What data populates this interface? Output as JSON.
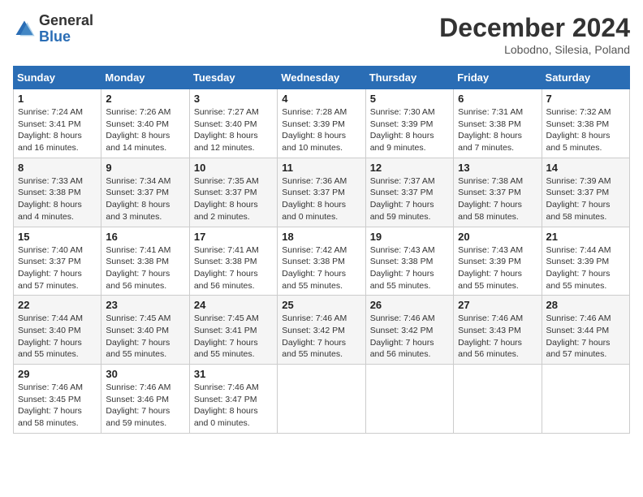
{
  "header": {
    "logo_general": "General",
    "logo_blue": "Blue",
    "month_title": "December 2024",
    "location": "Lobodno, Silesia, Poland"
  },
  "weekdays": [
    "Sunday",
    "Monday",
    "Tuesday",
    "Wednesday",
    "Thursday",
    "Friday",
    "Saturday"
  ],
  "weeks": [
    [
      {
        "day": "1",
        "sunrise": "7:24 AM",
        "sunset": "3:41 PM",
        "daylight": "8 hours and 16 minutes."
      },
      {
        "day": "2",
        "sunrise": "7:26 AM",
        "sunset": "3:40 PM",
        "daylight": "8 hours and 14 minutes."
      },
      {
        "day": "3",
        "sunrise": "7:27 AM",
        "sunset": "3:40 PM",
        "daylight": "8 hours and 12 minutes."
      },
      {
        "day": "4",
        "sunrise": "7:28 AM",
        "sunset": "3:39 PM",
        "daylight": "8 hours and 10 minutes."
      },
      {
        "day": "5",
        "sunrise": "7:30 AM",
        "sunset": "3:39 PM",
        "daylight": "8 hours and 9 minutes."
      },
      {
        "day": "6",
        "sunrise": "7:31 AM",
        "sunset": "3:38 PM",
        "daylight": "8 hours and 7 minutes."
      },
      {
        "day": "7",
        "sunrise": "7:32 AM",
        "sunset": "3:38 PM",
        "daylight": "8 hours and 5 minutes."
      }
    ],
    [
      {
        "day": "8",
        "sunrise": "7:33 AM",
        "sunset": "3:38 PM",
        "daylight": "8 hours and 4 minutes."
      },
      {
        "day": "9",
        "sunrise": "7:34 AM",
        "sunset": "3:37 PM",
        "daylight": "8 hours and 3 minutes."
      },
      {
        "day": "10",
        "sunrise": "7:35 AM",
        "sunset": "3:37 PM",
        "daylight": "8 hours and 2 minutes."
      },
      {
        "day": "11",
        "sunrise": "7:36 AM",
        "sunset": "3:37 PM",
        "daylight": "8 hours and 0 minutes."
      },
      {
        "day": "12",
        "sunrise": "7:37 AM",
        "sunset": "3:37 PM",
        "daylight": "7 hours and 59 minutes."
      },
      {
        "day": "13",
        "sunrise": "7:38 AM",
        "sunset": "3:37 PM",
        "daylight": "7 hours and 58 minutes."
      },
      {
        "day": "14",
        "sunrise": "7:39 AM",
        "sunset": "3:37 PM",
        "daylight": "7 hours and 58 minutes."
      }
    ],
    [
      {
        "day": "15",
        "sunrise": "7:40 AM",
        "sunset": "3:37 PM",
        "daylight": "7 hours and 57 minutes."
      },
      {
        "day": "16",
        "sunrise": "7:41 AM",
        "sunset": "3:38 PM",
        "daylight": "7 hours and 56 minutes."
      },
      {
        "day": "17",
        "sunrise": "7:41 AM",
        "sunset": "3:38 PM",
        "daylight": "7 hours and 56 minutes."
      },
      {
        "day": "18",
        "sunrise": "7:42 AM",
        "sunset": "3:38 PM",
        "daylight": "7 hours and 55 minutes."
      },
      {
        "day": "19",
        "sunrise": "7:43 AM",
        "sunset": "3:38 PM",
        "daylight": "7 hours and 55 minutes."
      },
      {
        "day": "20",
        "sunrise": "7:43 AM",
        "sunset": "3:39 PM",
        "daylight": "7 hours and 55 minutes."
      },
      {
        "day": "21",
        "sunrise": "7:44 AM",
        "sunset": "3:39 PM",
        "daylight": "7 hours and 55 minutes."
      }
    ],
    [
      {
        "day": "22",
        "sunrise": "7:44 AM",
        "sunset": "3:40 PM",
        "daylight": "7 hours and 55 minutes."
      },
      {
        "day": "23",
        "sunrise": "7:45 AM",
        "sunset": "3:40 PM",
        "daylight": "7 hours and 55 minutes."
      },
      {
        "day": "24",
        "sunrise": "7:45 AM",
        "sunset": "3:41 PM",
        "daylight": "7 hours and 55 minutes."
      },
      {
        "day": "25",
        "sunrise": "7:46 AM",
        "sunset": "3:42 PM",
        "daylight": "7 hours and 55 minutes."
      },
      {
        "day": "26",
        "sunrise": "7:46 AM",
        "sunset": "3:42 PM",
        "daylight": "7 hours and 56 minutes."
      },
      {
        "day": "27",
        "sunrise": "7:46 AM",
        "sunset": "3:43 PM",
        "daylight": "7 hours and 56 minutes."
      },
      {
        "day": "28",
        "sunrise": "7:46 AM",
        "sunset": "3:44 PM",
        "daylight": "7 hours and 57 minutes."
      }
    ],
    [
      {
        "day": "29",
        "sunrise": "7:46 AM",
        "sunset": "3:45 PM",
        "daylight": "7 hours and 58 minutes."
      },
      {
        "day": "30",
        "sunrise": "7:46 AM",
        "sunset": "3:46 PM",
        "daylight": "7 hours and 59 minutes."
      },
      {
        "day": "31",
        "sunrise": "7:46 AM",
        "sunset": "3:47 PM",
        "daylight": "8 hours and 0 minutes."
      },
      null,
      null,
      null,
      null
    ]
  ],
  "labels": {
    "sunrise": "Sunrise:",
    "sunset": "Sunset:",
    "daylight": "Daylight:"
  }
}
